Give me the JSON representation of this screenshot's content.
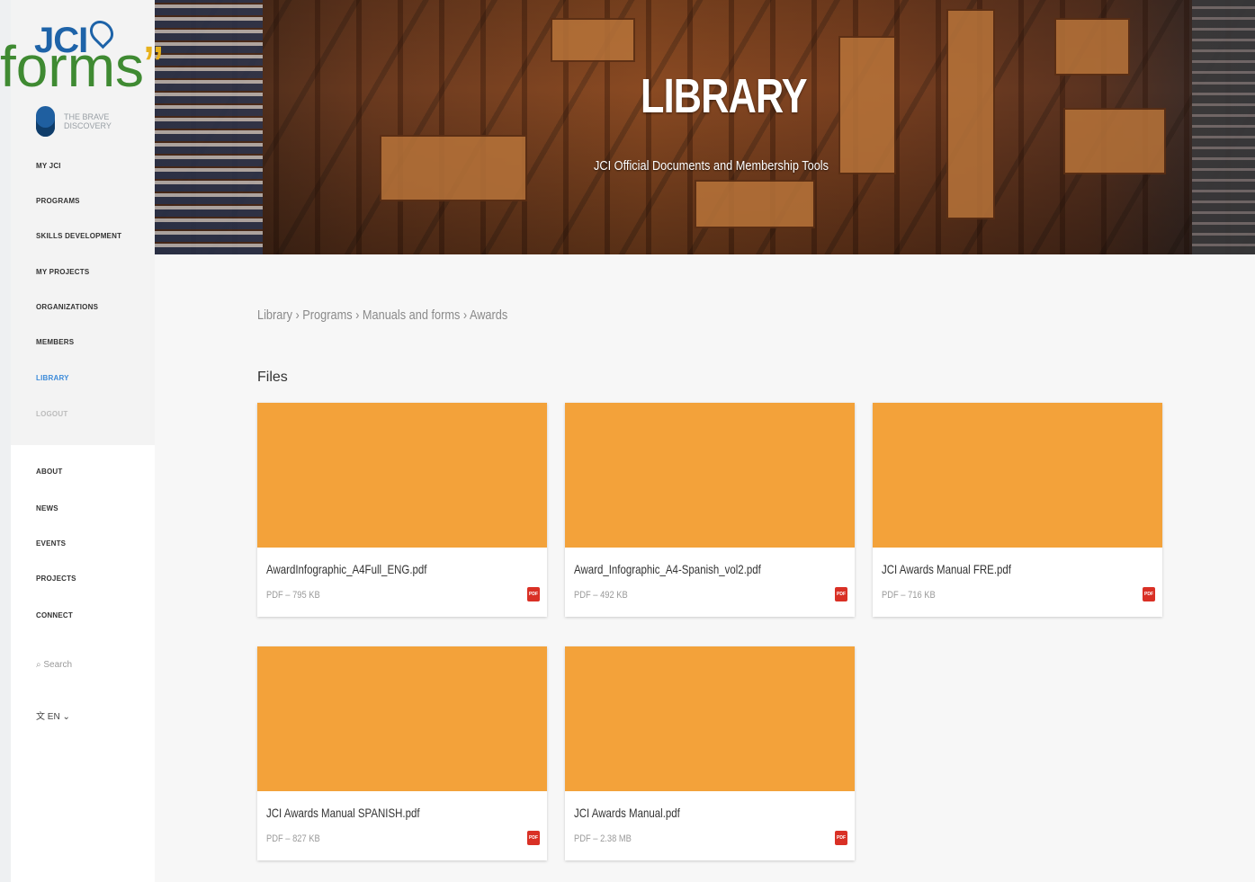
{
  "overlay": {
    "word": "forms",
    "quote": "”"
  },
  "sidebar": {
    "logo": "JCI",
    "user_name": "THE BRAVE DISCOVERY",
    "items_top": [
      {
        "label": "MY JCI",
        "state": "normal"
      },
      {
        "label": "PROGRAMS",
        "state": "normal"
      },
      {
        "label": "SKILLS DEVELOPMENT",
        "state": "normal"
      },
      {
        "label": "MY PROJECTS",
        "state": "normal"
      },
      {
        "label": "ORGANIZATIONS",
        "state": "normal"
      },
      {
        "label": "MEMBERS",
        "state": "normal"
      },
      {
        "label": "LIBRARY",
        "state": "active"
      },
      {
        "label": "LOGOUT",
        "state": "dim"
      }
    ],
    "items_bottom": [
      {
        "label": "ABOUT"
      },
      {
        "label": "NEWS"
      },
      {
        "label": "EVENTS"
      },
      {
        "label": "PROJECTS"
      },
      {
        "label": "CONNECT"
      }
    ],
    "search_label": "Search",
    "language": "文 EN ⌄"
  },
  "hero": {
    "title": "LIBRARY",
    "subtitle": "JCI Official Documents and Membership Tools"
  },
  "breadcrumb": "Library › Programs › Manuals and forms › Awards",
  "section_title": "Files",
  "files": [
    {
      "name": "AwardInfographic_A4Full_ENG.pdf",
      "meta": "PDF – 795 KB"
    },
    {
      "name": "Award_Infographic_A4-Spanish_vol2.pdf",
      "meta": "PDF – 492 KB"
    },
    {
      "name": "JCI Awards Manual FRE.pdf",
      "meta": "PDF – 716 KB"
    },
    {
      "name": "JCI Awards Manual SPANISH.pdf",
      "meta": "PDF – 827 KB"
    },
    {
      "name": "JCI Awards Manual.pdf",
      "meta": "PDF – 2.38 MB"
    }
  ],
  "colors": {
    "thumb": "#f3a23a",
    "active_nav": "#3b8ad9",
    "pdf_icon": "#d93025"
  },
  "icons": {
    "file_type": "pdf-icon",
    "search": "search-icon",
    "user": "avatar"
  }
}
